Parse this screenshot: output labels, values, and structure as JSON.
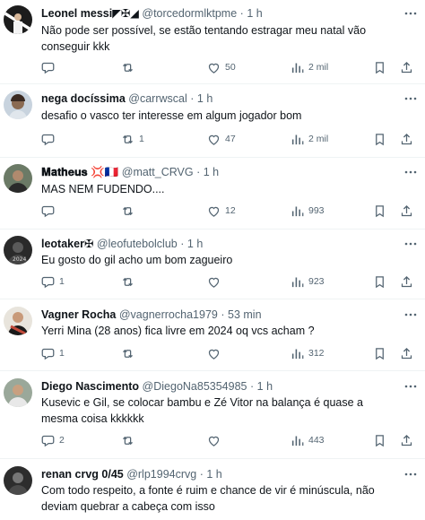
{
  "tweets": [
    {
      "name": "Leonel messi",
      "name_suffix": "◤✠◢",
      "handle": "@torcedormlktpme",
      "time": "1 h",
      "text": "Não pode ser possível, se estão tentando estragar meu natal vão conseguir kkk",
      "replies": "",
      "retweets": "",
      "likes": "50",
      "views": "2 mil",
      "avatar_color": "#1c1c1c"
    },
    {
      "name": "nega docíssima",
      "name_suffix": "",
      "handle": "@carrwscal",
      "time": "1 h",
      "text": "desafio o vasco ter interesse em algum jogador bom",
      "replies": "",
      "retweets": "1",
      "likes": "47",
      "views": "2 mil",
      "avatar_color": "#a9b7c5"
    },
    {
      "name": "𝐌𝐚𝐭𝐡𝐞𝐮𝐬",
      "name_suffix": "💢🇫🇷",
      "handle": "@matt_CRVG",
      "time": "1 h",
      "text": "MAS NEM FUDENDO....",
      "replies": "",
      "retweets": "",
      "likes": "12",
      "views": "993",
      "avatar_color": "#4a5a4a"
    },
    {
      "name": "leotaker✠",
      "name_suffix": "",
      "handle": "@leofutebolclub",
      "time": "1 h",
      "text": "Eu gosto do gil acho um bom zagueiro",
      "replies": "1",
      "retweets": "",
      "likes": "",
      "views": "923",
      "avatar_color": "#2a2a2a"
    },
    {
      "name": "Vagner Rocha",
      "name_suffix": "",
      "handle": "@vagnerrocha1979",
      "time": "53 min",
      "text": "Yerri Mina (28 anos) fica livre em 2024 oq vcs acham ?",
      "replies": "1",
      "retweets": "",
      "likes": "",
      "views": "312",
      "avatar_color": "#c24a3a"
    },
    {
      "name": "Diego Nascimento",
      "name_suffix": "",
      "handle": "@DiegoNa85354985",
      "time": "1 h",
      "text": "Kusevic e Gil, se colocar bambu e Zé Vitor na balança é quase a mesma coisa kkkkkk",
      "replies": "2",
      "retweets": "",
      "likes": "",
      "views": "443",
      "avatar_color": "#8a9a8a"
    },
    {
      "name": "renan crvg 0/45",
      "name_suffix": "",
      "handle": "@rlp1994crvg",
      "time": "1 h",
      "text": "Com todo respeito, a fonte é ruim e chance de vir é minúscula, não deviam quebrar a cabeça com isso",
      "replies": "",
      "retweets": "",
      "likes": "",
      "views": "",
      "avatar_color": "#2d2d2d"
    }
  ],
  "separator": "·"
}
